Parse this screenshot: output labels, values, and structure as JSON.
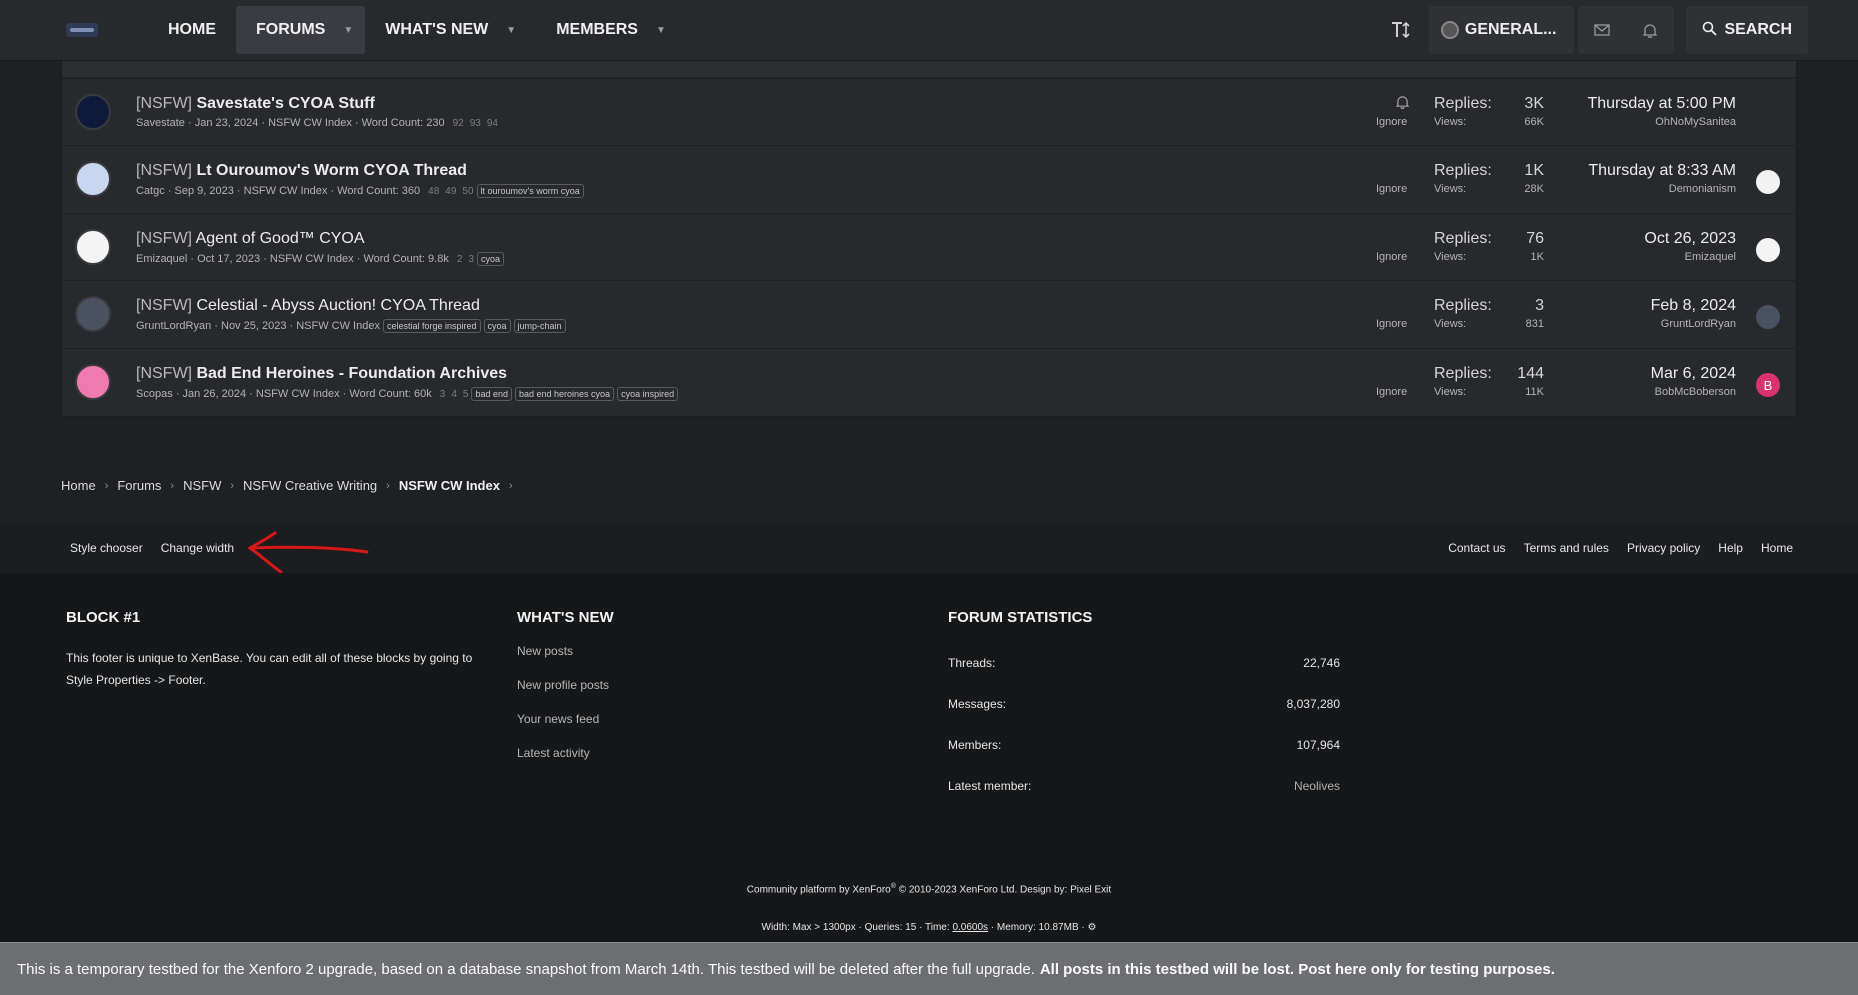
{
  "nav": {
    "tabs": [
      {
        "label": "HOME"
      },
      {
        "label": "FORUMS"
      },
      {
        "label": "WHAT'S NEW"
      },
      {
        "label": "MEMBERS"
      }
    ],
    "user_label": "GENERAL...",
    "search_label": "SEARCH"
  },
  "threads": [
    {
      "prefix": "[NSFW]",
      "title": "Savestate's CYOA Stuff",
      "unread": true,
      "author": "Savestate",
      "date": "Jan 23, 2024",
      "forum": "NSFW CW Index",
      "wordcount": "Word Count: 230",
      "pages": [
        "92",
        "93",
        "94"
      ],
      "tags": [],
      "ignore": "Ignore",
      "replies_label": "Replies:",
      "replies": "3K",
      "views_label": "Views:",
      "views": "66K",
      "last_date": "Thursday at 5:00 PM",
      "last_user": "OhNoMySanitea",
      "avatar_color": "#0d1a3a",
      "last_avatar_color": ""
    },
    {
      "prefix": "[NSFW]",
      "title": "Lt Ouroumov's Worm CYOA Thread",
      "unread": true,
      "author": "Catgc",
      "date": "Sep 9, 2023",
      "forum": "NSFW CW Index",
      "wordcount": "Word Count: 360",
      "pages": [
        "48",
        "49",
        "50"
      ],
      "tags": [
        "lt ouroumov's worm cyoa"
      ],
      "ignore": "Ignore",
      "replies_label": "Replies:",
      "replies": "1K",
      "views_label": "Views:",
      "views": "28K",
      "last_date": "Thursday at 8:33 AM",
      "last_user": "Demonianism",
      "avatar_color": "#c9d6f0",
      "last_avatar_color": "#f2f2f2"
    },
    {
      "prefix": "[NSFW]",
      "title": "Agent of Good™ CYOA",
      "unread": false,
      "author": "Emizaquel",
      "date": "Oct 17, 2023",
      "forum": "NSFW CW Index",
      "wordcount": "Word Count: 9.8k",
      "pages": [
        "2",
        "3"
      ],
      "tags": [
        "cyoa"
      ],
      "ignore": "Ignore",
      "replies_label": "Replies:",
      "replies": "76",
      "views_label": "Views:",
      "views": "1K",
      "last_date": "Oct 26, 2023",
      "last_user": "Emizaquel",
      "avatar_color": "#f4f4f4",
      "last_avatar_color": "#f4f4f4"
    },
    {
      "prefix": "[NSFW]",
      "title": "Celestial - Abyss Auction! CYOA Thread",
      "unread": false,
      "author": "GruntLordRyan",
      "date": "Nov 25, 2023",
      "forum": "NSFW CW Index",
      "wordcount": "",
      "pages": [],
      "tags": [
        "celestial forge inspired",
        "cyoa",
        "jump-chain"
      ],
      "ignore": "Ignore",
      "replies_label": "Replies:",
      "replies": "3",
      "views_label": "Views:",
      "views": "831",
      "last_date": "Feb 8, 2024",
      "last_user": "GruntLordRyan",
      "avatar_color": "#4a5160",
      "last_avatar_color": "#4a5160"
    },
    {
      "prefix": "[NSFW]",
      "title": "Bad End Heroines - Foundation Archives",
      "unread": true,
      "author": "Scopas",
      "date": "Jan 26, 2024",
      "forum": "NSFW CW Index",
      "wordcount": "Word Count: 60k",
      "pages": [
        "3",
        "4",
        "5"
      ],
      "tags": [
        "bad end",
        "bad end heroines cyoa",
        "cyoa inspired"
      ],
      "ignore": "Ignore",
      "replies_label": "Replies:",
      "replies": "144",
      "views_label": "Views:",
      "views": "11K",
      "last_date": "Mar 6, 2024",
      "last_user": "BobMcBoberson",
      "avatar_color": "#f07ab0",
      "last_avatar_color": "#d9336f",
      "last_avatar_letter": "B"
    }
  ],
  "breadcrumb": [
    "Home",
    "Forums",
    "NSFW",
    "NSFW Creative Writing",
    "NSFW CW Index"
  ],
  "footer_links_left": [
    "Style chooser",
    "Change width"
  ],
  "footer_links_right": [
    "Contact us",
    "Terms and rules",
    "Privacy policy",
    "Help",
    "Home"
  ],
  "block1": {
    "title": "BLOCK #1",
    "line1": "This footer is unique to XenBase. You can edit all of these blocks by going to",
    "line2": "Style Properties -> Footer."
  },
  "whats_new": {
    "title": "WHAT'S NEW",
    "links": [
      "New posts",
      "New profile posts",
      "Your news feed",
      "Latest activity"
    ]
  },
  "forum_stats": {
    "title": "FORUM STATISTICS",
    "rows": [
      {
        "label": "Threads:",
        "value": "22,746"
      },
      {
        "label": "Messages:",
        "value": "8,037,280"
      },
      {
        "label": "Members:",
        "value": "107,964"
      },
      {
        "label": "Latest member:",
        "value": "Neolives"
      }
    ]
  },
  "copyright": {
    "pre": "Community platform by XenForo",
    "reg": "®",
    "post": " © 2010-2023 XenForo Ltd. Design by: Pixel Exit"
  },
  "debug": {
    "pre": "Width: Max > 1300px · Queries: 15 · Time: ",
    "time": "0.0600s",
    "post": " · Memory: 10.87MB · "
  },
  "notice": {
    "text": "This is a temporary testbed for the Xenforo 2 upgrade, based on a database snapshot from March 14th. This testbed will be deleted after the full upgrade.",
    "bold": "All posts in this testbed will be lost. Post here only for testing purposes."
  }
}
